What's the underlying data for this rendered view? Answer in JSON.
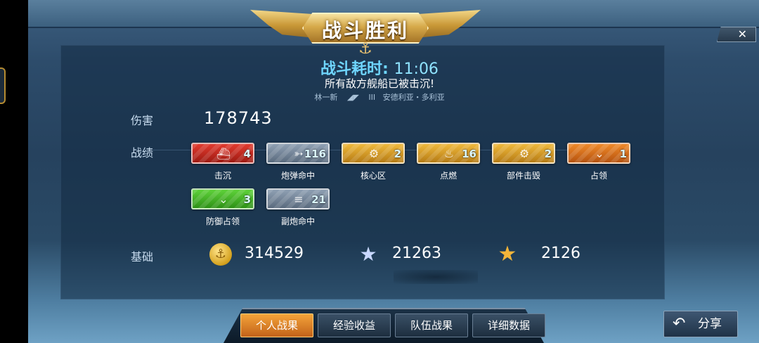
{
  "banner": {
    "title": "战斗胜利"
  },
  "close": {
    "symbol": "✕"
  },
  "summary": {
    "time_label": "战斗耗时:",
    "time_value": "11:06",
    "message": "所有敌方舰船已被击沉!",
    "commander": "林一新",
    "tier": "III",
    "ship": "安德利亚・多利亚"
  },
  "damage": {
    "label": "伤害",
    "value": "178743"
  },
  "achievements": {
    "label": "战绩",
    "items": [
      {
        "label": "击沉",
        "count": "4",
        "icon": "ship-sink-icon",
        "color_top": "#e23b2f",
        "color_bottom": "#9e1a12"
      },
      {
        "label": "炮弹命中",
        "count": "116",
        "icon": "shell-icon",
        "color_top": "#8fa0b3",
        "color_bottom": "#5a6b7e"
      },
      {
        "label": "核心区",
        "count": "2",
        "icon": "ship-core-icon",
        "color_top": "#f0b93c",
        "color_bottom": "#b57b14"
      },
      {
        "label": "点燃",
        "count": "16",
        "icon": "fire-icon",
        "color_top": "#f0b93c",
        "color_bottom": "#b57b14"
      },
      {
        "label": "部件击毁",
        "count": "2",
        "icon": "gear-icon",
        "color_top": "#f0b93c",
        "color_bottom": "#b57b14"
      },
      {
        "label": "占领",
        "count": "1",
        "icon": "chevron-down-icon",
        "color_top": "#f08a2a",
        "color_bottom": "#b5520e"
      },
      {
        "label": "防御占领",
        "count": "3",
        "icon": "defend-capture-icon",
        "color_top": "#5fd23a",
        "color_bottom": "#2d9116"
      },
      {
        "label": "副炮命中",
        "count": "21",
        "icon": "secondary-gun-icon",
        "color_top": "#8fa0b3",
        "color_bottom": "#5a6b7e"
      }
    ]
  },
  "base": {
    "label": "基础",
    "credits": {
      "value": "314529",
      "icon": "coin-icon"
    },
    "experience": {
      "value": "21263",
      "icon": "star-icon"
    },
    "commander_xp": {
      "value": "2126",
      "icon": "gold-star-icon"
    }
  },
  "tabs": [
    {
      "label": "个人战果",
      "active": true
    },
    {
      "label": "经验收益",
      "active": false
    },
    {
      "label": "队伍战果",
      "active": false
    },
    {
      "label": "详细数据",
      "active": false
    }
  ],
  "share": {
    "label": "分享",
    "icon": "share-arrow-icon"
  }
}
